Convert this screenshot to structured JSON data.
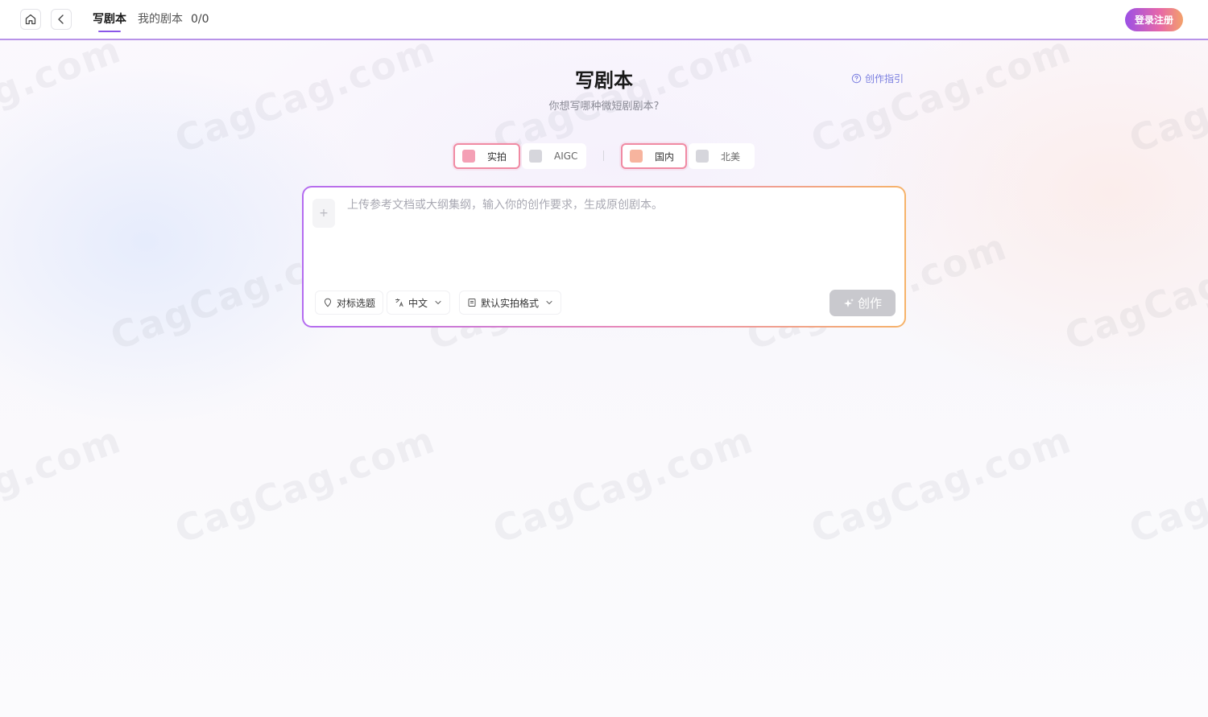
{
  "header": {
    "nav": [
      {
        "label": "写剧本",
        "active": true
      },
      {
        "label": "我的剧本",
        "active": false
      }
    ],
    "count": "0/0",
    "login_label": "登录注册"
  },
  "main": {
    "title": "写剧本",
    "subtitle": "你想写哪种微短剧剧本?",
    "guide_label": "创作指引",
    "mode_options": [
      {
        "label": "实拍",
        "selected": true
      },
      {
        "label": "AIGC",
        "selected": false
      }
    ],
    "region_options": [
      {
        "label": "国内",
        "selected": true
      },
      {
        "label": "北美",
        "selected": false
      }
    ],
    "composer": {
      "upload_symbol": "+",
      "placeholder": "上传参考文档或大纲集纲，输入你的创作要求，生成原创剧本。",
      "benchmark_label": "对标选题",
      "language_label": "中文",
      "format_label": "默认实拍格式",
      "create_label": "创作"
    }
  },
  "watermark_text": "CagCag.com",
  "colors": {
    "accent_purple": "#8a56e8",
    "selected_border": "#f08aa3",
    "guide_link": "#7b7fe0",
    "create_disabled": "#c9c9ce"
  }
}
